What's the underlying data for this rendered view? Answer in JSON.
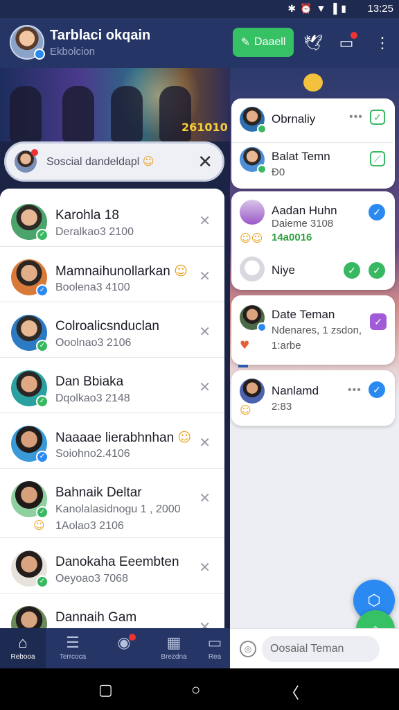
{
  "status_bar": {
    "time": "13:25",
    "icons": [
      "bluetooth-icon",
      "alarm-icon",
      "wifi-icon",
      "signal-icon",
      "battery-icon"
    ]
  },
  "app_bar": {
    "title": "Tarblaci okqain",
    "subtitle": "Ekbolcion",
    "action_label": "Daaell",
    "icons": [
      "pencil-icon",
      "bird-icon",
      "chat-icon",
      "more-icon"
    ]
  },
  "banner": {
    "score": "261010"
  },
  "search": {
    "placeholder": "Soscial dandeldapl"
  },
  "contacts": [
    {
      "name": "Karohla 18",
      "sub": "Deralkao3 2100",
      "sub2": ""
    },
    {
      "name": "Mamnaihunollarkan",
      "sub": "Boolena3 4100",
      "sub2": ""
    },
    {
      "name": "Colroalicsnduclan",
      "sub": "Ooolnao3 2106",
      "sub2": ""
    },
    {
      "name": "Dan Bbiaka",
      "sub": "Dqolkao3 2148",
      "sub2": ""
    },
    {
      "name": "Naaaae lierabhnhan",
      "sub": "Soiohno2.4106",
      "sub2": ""
    },
    {
      "name": "Bahnaik Deltar",
      "sub": "Kanolalasidnogu 1 , 2000",
      "sub2": "1Aolao3 2106"
    },
    {
      "name": "Danokaha Eeembten",
      "sub": "Oeyoao3 7068",
      "sub2": ""
    },
    {
      "name": "Dannaih Gam",
      "sub": "",
      "sub2": ""
    }
  ],
  "right_cards": {
    "card1": [
      {
        "name": "Obrnaliy",
        "sub": ""
      },
      {
        "name": "Balat Temn",
        "sub": "Ð0"
      }
    ],
    "card2": [
      {
        "name": "Aadan Huhn",
        "sub": "Daieme 3108",
        "sub3": "14a0016"
      },
      {
        "name": "Niye",
        "sub": ""
      }
    ],
    "card3": [
      {
        "name": "Date Teman",
        "sub": "Ndenares, 1 zsdon,",
        "sub2": "1:arbe"
      }
    ],
    "card4": [
      {
        "name": "Nanlamd",
        "sub": "2:83"
      }
    ]
  },
  "compose": {
    "placeholder": "Oosaial Teman"
  },
  "bottom_nav": [
    {
      "label": "Rebooa",
      "icon": "home-icon"
    },
    {
      "label": "Terrcoca",
      "icon": "menu-icon"
    },
    {
      "label": "",
      "icon": "globe-icon"
    },
    {
      "label": "Brezdna",
      "icon": "calendar-icon"
    },
    {
      "label": "Rea",
      "icon": "folder-icon"
    }
  ],
  "colors": {
    "appbar": "#253565",
    "accent_green": "#35c164",
    "accent_blue": "#2b8af1"
  }
}
